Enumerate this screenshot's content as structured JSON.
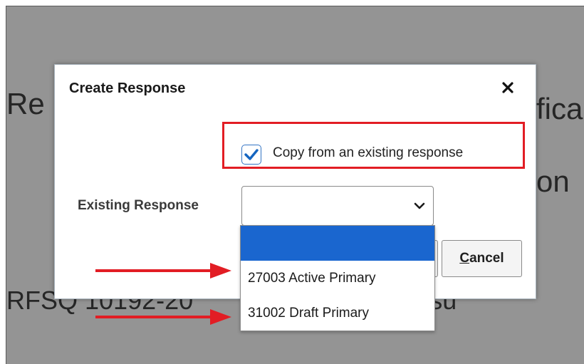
{
  "background": {
    "text_re": "Re",
    "text_fica": "fica",
    "text_on": "on",
    "text_rfsq": "RFSQ 10192-20",
    "text_consu": "ess Consu"
  },
  "dialog": {
    "title": "Create Response",
    "close_icon": "close-icon",
    "copy_checkbox": {
      "label": "Copy from an existing response",
      "checked": true
    },
    "existing_response": {
      "label": "Existing Response",
      "selected_value": ""
    },
    "cancel_label_mnemonic": "C",
    "cancel_label_rest": "ancel"
  },
  "dropdown": {
    "options": [
      "",
      "27003 Active Primary",
      "31002 Draft Primary"
    ],
    "selected_index": 0
  },
  "colors": {
    "annotation_red": "#e21d24",
    "selection_blue": "#1a66cf",
    "checkbox_blue": "#1565c0",
    "backdrop_gray": "#949494"
  }
}
